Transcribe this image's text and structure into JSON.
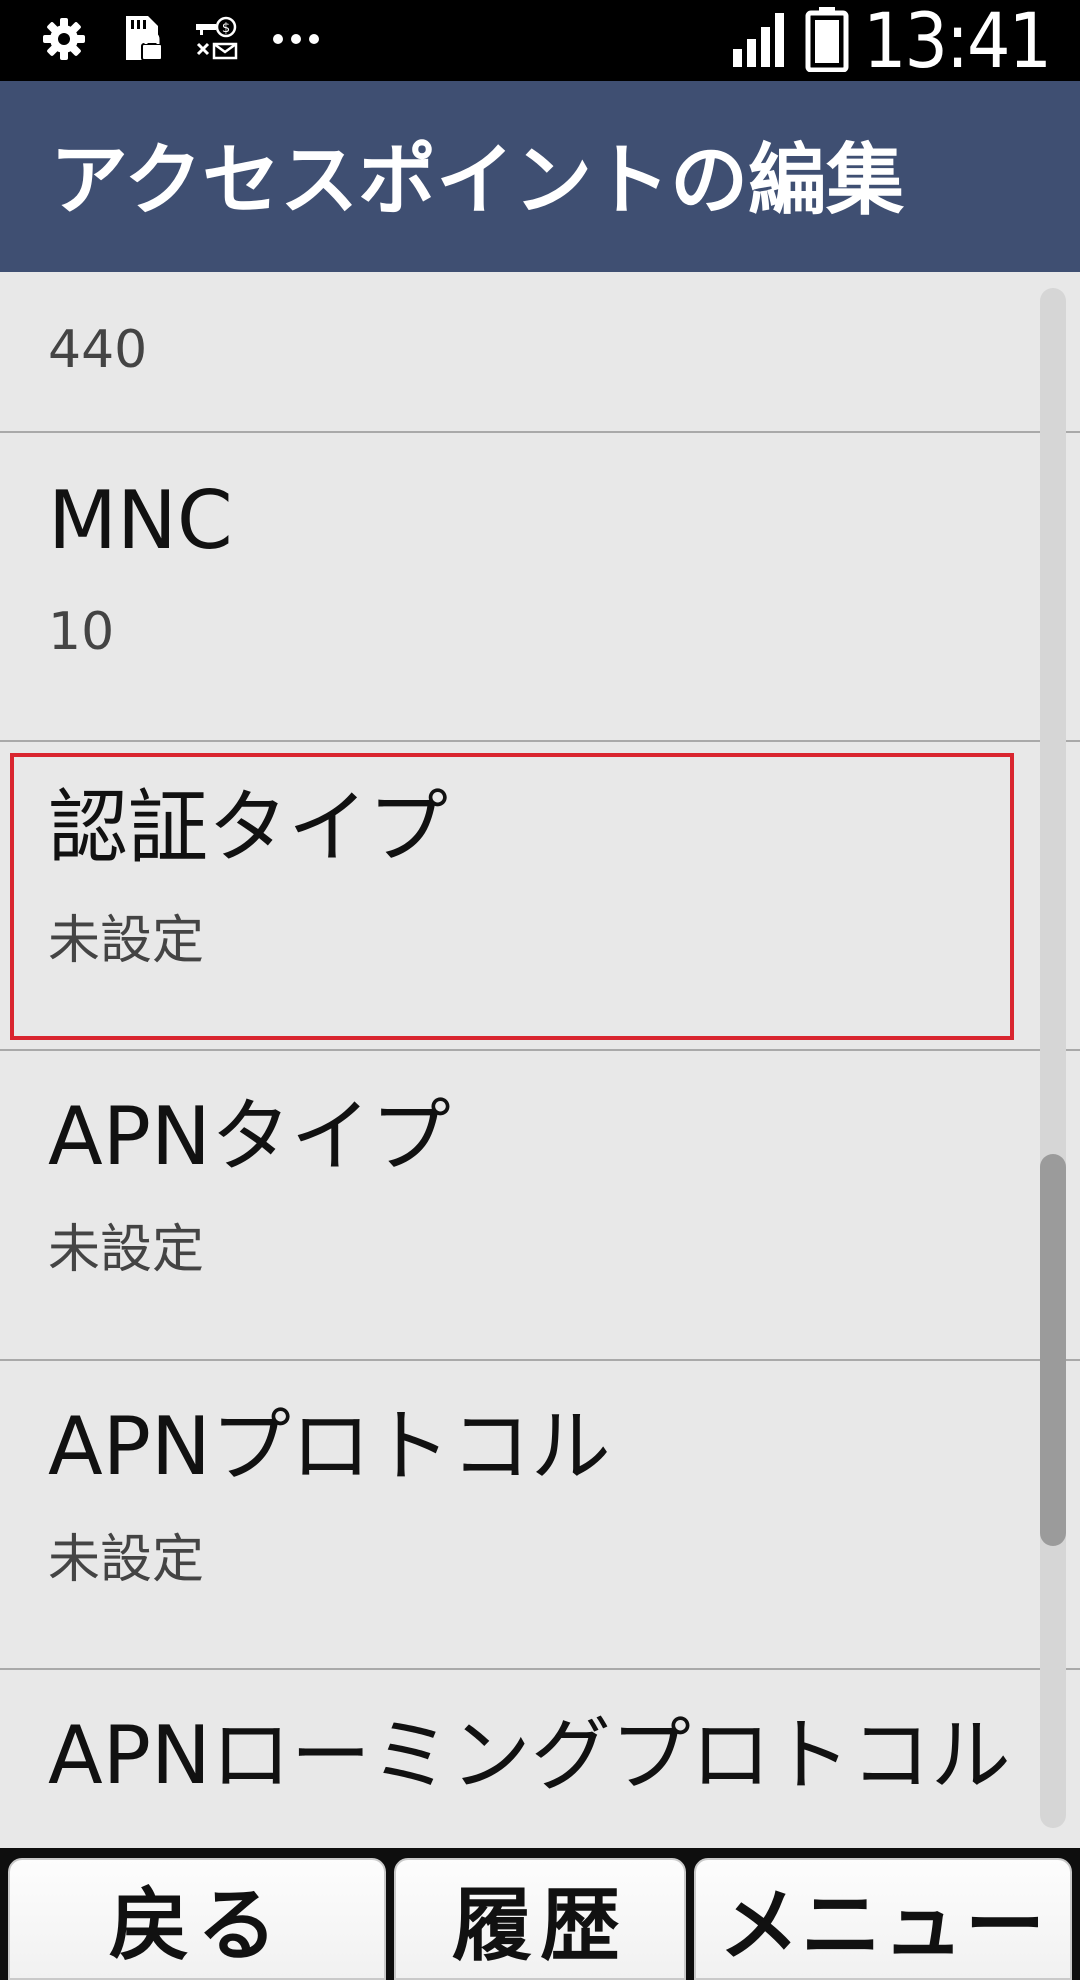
{
  "status_bar": {
    "time": "13:41",
    "icons": [
      "gear-icon",
      "sd-card-lock-icon",
      "key-money-mail-icon",
      "more-dots-icon",
      "signal-icon",
      "battery-icon"
    ]
  },
  "header": {
    "title": "アクセスポイントの編集"
  },
  "settings": {
    "mcc_value": "440",
    "mnc": {
      "title": "MNC",
      "value": "10"
    },
    "auth_type": {
      "title": "認証タイプ",
      "value": "未設定"
    },
    "apn_type": {
      "title": "APNタイプ",
      "value": "未設定"
    },
    "apn_protocol": {
      "title": "APNプロトコル",
      "value": "未設定"
    },
    "apn_roaming_protocol": {
      "title": "APNローミングプロトコル"
    }
  },
  "soft_keys": {
    "back": "戻る",
    "history": "履歴",
    "menu": "メニュー"
  },
  "colors": {
    "header_bg": "#3f4f72",
    "focus_border": "#d9252f",
    "list_bg": "#e8e8e8"
  }
}
